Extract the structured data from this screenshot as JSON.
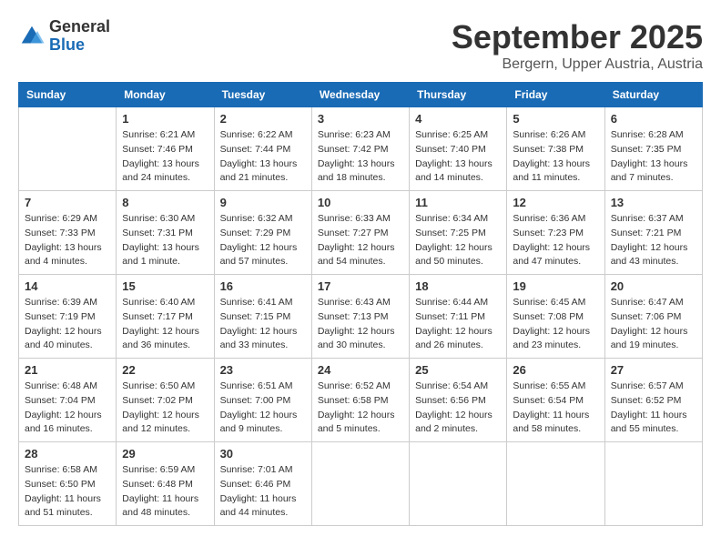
{
  "logo": {
    "general": "General",
    "blue": "Blue"
  },
  "header": {
    "month": "September 2025",
    "location": "Bergern, Upper Austria, Austria"
  },
  "weekdays": [
    "Sunday",
    "Monday",
    "Tuesday",
    "Wednesday",
    "Thursday",
    "Friday",
    "Saturday"
  ],
  "weeks": [
    [
      {
        "day": "",
        "info": ""
      },
      {
        "day": "1",
        "info": "Sunrise: 6:21 AM\nSunset: 7:46 PM\nDaylight: 13 hours\nand 24 minutes."
      },
      {
        "day": "2",
        "info": "Sunrise: 6:22 AM\nSunset: 7:44 PM\nDaylight: 13 hours\nand 21 minutes."
      },
      {
        "day": "3",
        "info": "Sunrise: 6:23 AM\nSunset: 7:42 PM\nDaylight: 13 hours\nand 18 minutes."
      },
      {
        "day": "4",
        "info": "Sunrise: 6:25 AM\nSunset: 7:40 PM\nDaylight: 13 hours\nand 14 minutes."
      },
      {
        "day": "5",
        "info": "Sunrise: 6:26 AM\nSunset: 7:38 PM\nDaylight: 13 hours\nand 11 minutes."
      },
      {
        "day": "6",
        "info": "Sunrise: 6:28 AM\nSunset: 7:35 PM\nDaylight: 13 hours\nand 7 minutes."
      }
    ],
    [
      {
        "day": "7",
        "info": "Sunrise: 6:29 AM\nSunset: 7:33 PM\nDaylight: 13 hours\nand 4 minutes."
      },
      {
        "day": "8",
        "info": "Sunrise: 6:30 AM\nSunset: 7:31 PM\nDaylight: 13 hours\nand 1 minute."
      },
      {
        "day": "9",
        "info": "Sunrise: 6:32 AM\nSunset: 7:29 PM\nDaylight: 12 hours\nand 57 minutes."
      },
      {
        "day": "10",
        "info": "Sunrise: 6:33 AM\nSunset: 7:27 PM\nDaylight: 12 hours\nand 54 minutes."
      },
      {
        "day": "11",
        "info": "Sunrise: 6:34 AM\nSunset: 7:25 PM\nDaylight: 12 hours\nand 50 minutes."
      },
      {
        "day": "12",
        "info": "Sunrise: 6:36 AM\nSunset: 7:23 PM\nDaylight: 12 hours\nand 47 minutes."
      },
      {
        "day": "13",
        "info": "Sunrise: 6:37 AM\nSunset: 7:21 PM\nDaylight: 12 hours\nand 43 minutes."
      }
    ],
    [
      {
        "day": "14",
        "info": "Sunrise: 6:39 AM\nSunset: 7:19 PM\nDaylight: 12 hours\nand 40 minutes."
      },
      {
        "day": "15",
        "info": "Sunrise: 6:40 AM\nSunset: 7:17 PM\nDaylight: 12 hours\nand 36 minutes."
      },
      {
        "day": "16",
        "info": "Sunrise: 6:41 AM\nSunset: 7:15 PM\nDaylight: 12 hours\nand 33 minutes."
      },
      {
        "day": "17",
        "info": "Sunrise: 6:43 AM\nSunset: 7:13 PM\nDaylight: 12 hours\nand 30 minutes."
      },
      {
        "day": "18",
        "info": "Sunrise: 6:44 AM\nSunset: 7:11 PM\nDaylight: 12 hours\nand 26 minutes."
      },
      {
        "day": "19",
        "info": "Sunrise: 6:45 AM\nSunset: 7:08 PM\nDaylight: 12 hours\nand 23 minutes."
      },
      {
        "day": "20",
        "info": "Sunrise: 6:47 AM\nSunset: 7:06 PM\nDaylight: 12 hours\nand 19 minutes."
      }
    ],
    [
      {
        "day": "21",
        "info": "Sunrise: 6:48 AM\nSunset: 7:04 PM\nDaylight: 12 hours\nand 16 minutes."
      },
      {
        "day": "22",
        "info": "Sunrise: 6:50 AM\nSunset: 7:02 PM\nDaylight: 12 hours\nand 12 minutes."
      },
      {
        "day": "23",
        "info": "Sunrise: 6:51 AM\nSunset: 7:00 PM\nDaylight: 12 hours\nand 9 minutes."
      },
      {
        "day": "24",
        "info": "Sunrise: 6:52 AM\nSunset: 6:58 PM\nDaylight: 12 hours\nand 5 minutes."
      },
      {
        "day": "25",
        "info": "Sunrise: 6:54 AM\nSunset: 6:56 PM\nDaylight: 12 hours\nand 2 minutes."
      },
      {
        "day": "26",
        "info": "Sunrise: 6:55 AM\nSunset: 6:54 PM\nDaylight: 11 hours\nand 58 minutes."
      },
      {
        "day": "27",
        "info": "Sunrise: 6:57 AM\nSunset: 6:52 PM\nDaylight: 11 hours\nand 55 minutes."
      }
    ],
    [
      {
        "day": "28",
        "info": "Sunrise: 6:58 AM\nSunset: 6:50 PM\nDaylight: 11 hours\nand 51 minutes."
      },
      {
        "day": "29",
        "info": "Sunrise: 6:59 AM\nSunset: 6:48 PM\nDaylight: 11 hours\nand 48 minutes."
      },
      {
        "day": "30",
        "info": "Sunrise: 7:01 AM\nSunset: 6:46 PM\nDaylight: 11 hours\nand 44 minutes."
      },
      {
        "day": "",
        "info": ""
      },
      {
        "day": "",
        "info": ""
      },
      {
        "day": "",
        "info": ""
      },
      {
        "day": "",
        "info": ""
      }
    ]
  ]
}
